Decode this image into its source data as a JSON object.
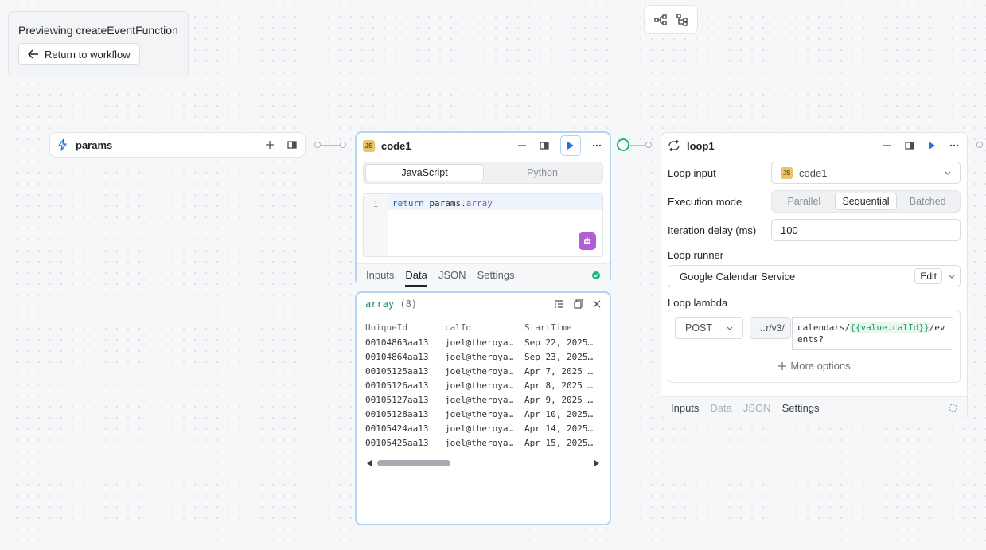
{
  "preview": {
    "title": "Previewing createEventFunction",
    "return_label": "Return to workflow"
  },
  "toolbar": {
    "icons": [
      "flow-layout-icon",
      "tree-layout-icon"
    ]
  },
  "params_node": {
    "title": "params"
  },
  "code_node": {
    "title": "code1",
    "lang_tabs": [
      "JavaScript",
      "Python"
    ],
    "active_lang": "JavaScript",
    "line_number": "1",
    "code": {
      "kw": "return",
      "obj": " params.",
      "prop": "array"
    },
    "tabs": [
      "Inputs",
      "Data",
      "JSON",
      "Settings"
    ],
    "active_tab": "Data"
  },
  "data_panel": {
    "title": "array",
    "count": "(8)",
    "columns": [
      "UniqueId",
      "calId",
      "StartTime"
    ],
    "rows": [
      [
        "00104863aa13",
        "joel@theroya…",
        "Sep 22, 2025…"
      ],
      [
        "00104864aa13",
        "joel@theroya…",
        "Sep 23, 2025…"
      ],
      [
        "00105125aa13",
        "joel@theroya…",
        "Apr 7, 2025 …"
      ],
      [
        "00105126aa13",
        "joel@theroya…",
        "Apr 8, 2025 …"
      ],
      [
        "00105127aa13",
        "joel@theroya…",
        "Apr 9, 2025 …"
      ],
      [
        "00105128aa13",
        "joel@theroya…",
        "Apr 10, 2025…"
      ],
      [
        "00105424aa13",
        "joel@theroya…",
        "Apr 14, 2025…"
      ],
      [
        "00105425aa13",
        "joel@theroya…",
        "Apr 15, 2025…"
      ]
    ]
  },
  "loop_node": {
    "title": "loop1",
    "loop_input_label": "Loop input",
    "loop_input_value": "code1",
    "execution_mode_label": "Execution mode",
    "modes": [
      "Parallel",
      "Sequential",
      "Batched"
    ],
    "active_mode": "Sequential",
    "iteration_delay_label": "Iteration delay (ms)",
    "iteration_delay_value": "100",
    "loop_runner_label": "Loop runner",
    "loop_runner_value": "Google Calendar Service",
    "edit_label": "Edit",
    "loop_lambda_label": "Loop lambda",
    "method": "POST",
    "base_url": "…r/v3/",
    "path_prefix": "calendars/",
    "path_template": "{{value.calId}}",
    "path_suffix": "/events?",
    "more_options": "More options",
    "tabs": [
      "Inputs",
      "Data",
      "JSON",
      "Settings"
    ]
  },
  "colors": {
    "accent": "#2a6fdb",
    "success": "#1fb57a",
    "selection": "#b5d3f3"
  }
}
